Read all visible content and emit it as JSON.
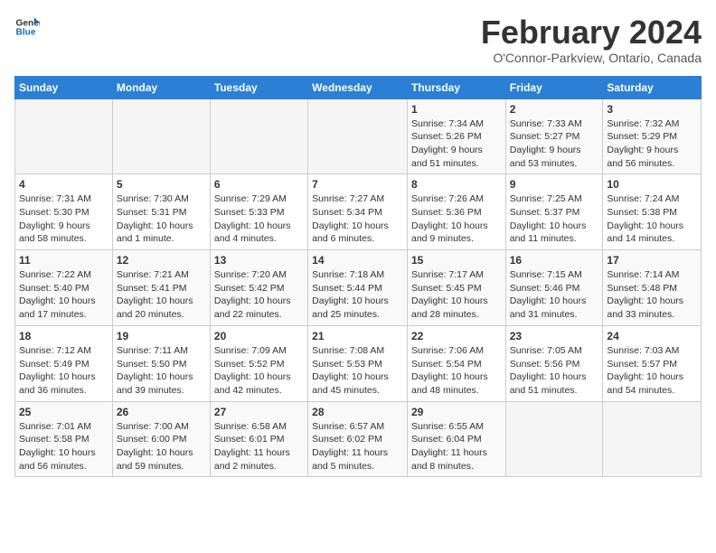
{
  "header": {
    "logo_general": "General",
    "logo_blue": "Blue",
    "title": "February 2024",
    "subtitle": "O'Connor-Parkview, Ontario, Canada"
  },
  "weekdays": [
    "Sunday",
    "Monday",
    "Tuesday",
    "Wednesday",
    "Thursday",
    "Friday",
    "Saturday"
  ],
  "weeks": [
    [
      {
        "day": "",
        "info": ""
      },
      {
        "day": "",
        "info": ""
      },
      {
        "day": "",
        "info": ""
      },
      {
        "day": "",
        "info": ""
      },
      {
        "day": "1",
        "info": "Sunrise: 7:34 AM\nSunset: 5:26 PM\nDaylight: 9 hours\nand 51 minutes."
      },
      {
        "day": "2",
        "info": "Sunrise: 7:33 AM\nSunset: 5:27 PM\nDaylight: 9 hours\nand 53 minutes."
      },
      {
        "day": "3",
        "info": "Sunrise: 7:32 AM\nSunset: 5:29 PM\nDaylight: 9 hours\nand 56 minutes."
      }
    ],
    [
      {
        "day": "4",
        "info": "Sunrise: 7:31 AM\nSunset: 5:30 PM\nDaylight: 9 hours\nand 58 minutes."
      },
      {
        "day": "5",
        "info": "Sunrise: 7:30 AM\nSunset: 5:31 PM\nDaylight: 10 hours\nand 1 minute."
      },
      {
        "day": "6",
        "info": "Sunrise: 7:29 AM\nSunset: 5:33 PM\nDaylight: 10 hours\nand 4 minutes."
      },
      {
        "day": "7",
        "info": "Sunrise: 7:27 AM\nSunset: 5:34 PM\nDaylight: 10 hours\nand 6 minutes."
      },
      {
        "day": "8",
        "info": "Sunrise: 7:26 AM\nSunset: 5:36 PM\nDaylight: 10 hours\nand 9 minutes."
      },
      {
        "day": "9",
        "info": "Sunrise: 7:25 AM\nSunset: 5:37 PM\nDaylight: 10 hours\nand 11 minutes."
      },
      {
        "day": "10",
        "info": "Sunrise: 7:24 AM\nSunset: 5:38 PM\nDaylight: 10 hours\nand 14 minutes."
      }
    ],
    [
      {
        "day": "11",
        "info": "Sunrise: 7:22 AM\nSunset: 5:40 PM\nDaylight: 10 hours\nand 17 minutes."
      },
      {
        "day": "12",
        "info": "Sunrise: 7:21 AM\nSunset: 5:41 PM\nDaylight: 10 hours\nand 20 minutes."
      },
      {
        "day": "13",
        "info": "Sunrise: 7:20 AM\nSunset: 5:42 PM\nDaylight: 10 hours\nand 22 minutes."
      },
      {
        "day": "14",
        "info": "Sunrise: 7:18 AM\nSunset: 5:44 PM\nDaylight: 10 hours\nand 25 minutes."
      },
      {
        "day": "15",
        "info": "Sunrise: 7:17 AM\nSunset: 5:45 PM\nDaylight: 10 hours\nand 28 minutes."
      },
      {
        "day": "16",
        "info": "Sunrise: 7:15 AM\nSunset: 5:46 PM\nDaylight: 10 hours\nand 31 minutes."
      },
      {
        "day": "17",
        "info": "Sunrise: 7:14 AM\nSunset: 5:48 PM\nDaylight: 10 hours\nand 33 minutes."
      }
    ],
    [
      {
        "day": "18",
        "info": "Sunrise: 7:12 AM\nSunset: 5:49 PM\nDaylight: 10 hours\nand 36 minutes."
      },
      {
        "day": "19",
        "info": "Sunrise: 7:11 AM\nSunset: 5:50 PM\nDaylight: 10 hours\nand 39 minutes."
      },
      {
        "day": "20",
        "info": "Sunrise: 7:09 AM\nSunset: 5:52 PM\nDaylight: 10 hours\nand 42 minutes."
      },
      {
        "day": "21",
        "info": "Sunrise: 7:08 AM\nSunset: 5:53 PM\nDaylight: 10 hours\nand 45 minutes."
      },
      {
        "day": "22",
        "info": "Sunrise: 7:06 AM\nSunset: 5:54 PM\nDaylight: 10 hours\nand 48 minutes."
      },
      {
        "day": "23",
        "info": "Sunrise: 7:05 AM\nSunset: 5:56 PM\nDaylight: 10 hours\nand 51 minutes."
      },
      {
        "day": "24",
        "info": "Sunrise: 7:03 AM\nSunset: 5:57 PM\nDaylight: 10 hours\nand 54 minutes."
      }
    ],
    [
      {
        "day": "25",
        "info": "Sunrise: 7:01 AM\nSunset: 5:58 PM\nDaylight: 10 hours\nand 56 minutes."
      },
      {
        "day": "26",
        "info": "Sunrise: 7:00 AM\nSunset: 6:00 PM\nDaylight: 10 hours\nand 59 minutes."
      },
      {
        "day": "27",
        "info": "Sunrise: 6:58 AM\nSunset: 6:01 PM\nDaylight: 11 hours\nand 2 minutes."
      },
      {
        "day": "28",
        "info": "Sunrise: 6:57 AM\nSunset: 6:02 PM\nDaylight: 11 hours\nand 5 minutes."
      },
      {
        "day": "29",
        "info": "Sunrise: 6:55 AM\nSunset: 6:04 PM\nDaylight: 11 hours\nand 8 minutes."
      },
      {
        "day": "",
        "info": ""
      },
      {
        "day": "",
        "info": ""
      }
    ]
  ]
}
